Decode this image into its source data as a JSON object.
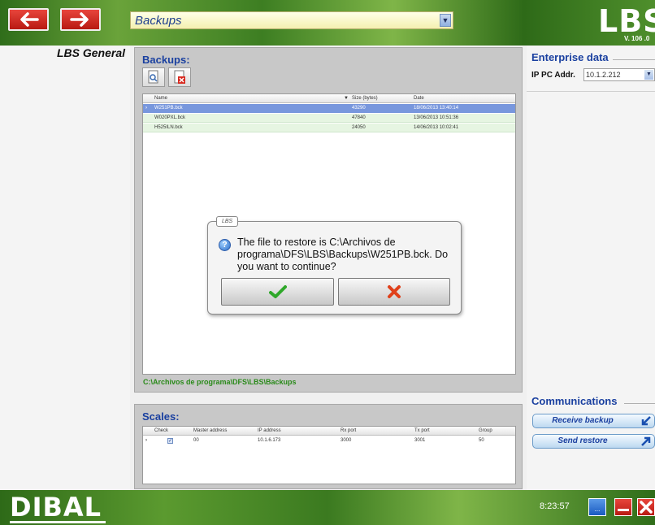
{
  "topbar": {
    "screen_selector": "Backups",
    "logo": "LBS",
    "version": "V. 106 .0"
  },
  "left_title": "LBS General",
  "backups": {
    "title": "Backups:",
    "columns": [
      "Name",
      "Size (bytes)",
      "Date"
    ],
    "rows": [
      {
        "name": "W251PB.bck",
        "size": "43290",
        "date": "18/06/2013 13:40:14"
      },
      {
        "name": "W020PXL.bck",
        "size": "47840",
        "date": "13/06/2013 10:51:36"
      },
      {
        "name": "H525ILN.bck",
        "size": "24050",
        "date": "14/06/2013 10:02:41"
      }
    ],
    "path": "C:\\Archivos de programa\\DFS\\LBS\\Backups"
  },
  "dialog": {
    "tag": "LBS",
    "message": "The file to restore is C:\\Archivos de programa\\DFS\\LBS\\Backups\\W251PB.bck. Do you want to continue?"
  },
  "scales": {
    "title": "Scales:",
    "columns": [
      "Check",
      "Master address",
      "IP address",
      "Rx port",
      "Tx port",
      "Group"
    ],
    "rows": [
      {
        "master": "00",
        "ip": "10.1.6.173",
        "rx": "3000",
        "tx": "3001",
        "group": "50"
      }
    ]
  },
  "enterprise": {
    "title": "Enterprise data",
    "ip_label": "IP PC Addr.",
    "ip_value": "10.1.2.212"
  },
  "communications": {
    "title": "Communications",
    "receive_label": "Receive backup",
    "send_label": "Send restore"
  },
  "bottombar": {
    "logo": "DIBAL",
    "clock": "8:23:57",
    "keyboard_label": "..."
  },
  "colors": {
    "accent_blue": "#1a40a0",
    "path_green": "#2a8a1a",
    "selected_row": "#7897dd",
    "danger_red": "#c8241a"
  }
}
